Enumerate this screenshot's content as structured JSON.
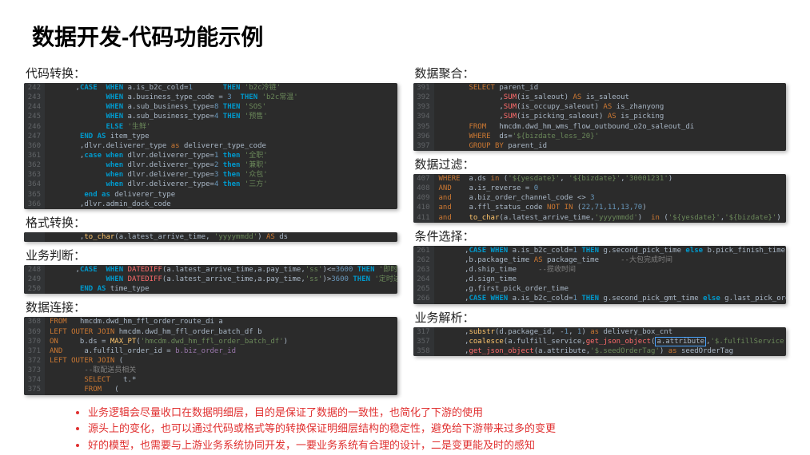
{
  "title": "数据开发-代码功能示例",
  "left": {
    "s1_label": "代码转换：",
    "s1_lines": [
      {
        "n": "242",
        "t": "      ,<kw2>CASE</kw2>  <kw2>WHEN</kw2> a.is_b2c_cold=<num>1</num>       <kw2>THEN</kw2> <str>'b2c冷链'</str>"
      },
      {
        "n": "243",
        "t": "             <kw2>WHEN</kw2> a.business_type_code = <num>3</num>  <kw2>THEN</kw2> <str>'b2c常温'</str>"
      },
      {
        "n": "244",
        "t": "             <kw2>WHEN</kw2> a.sub_business_type=<num>8</num> <kw2>THEN</kw2> <str>'SOS'</str>"
      },
      {
        "n": "245",
        "t": "             <kw2>WHEN</kw2> a.sub_business_type=<num>4</num> <kw2>THEN</kw2> <str>'预售'</str>"
      },
      {
        "n": "246",
        "t": "             <kw2>ELSE</kw2> <str>'生鲜'</str>"
      },
      {
        "n": "247",
        "t": "       <kw2>END AS</kw2> item_type"
      },
      {
        "n": "360",
        "t": "       ,dlvr.deliverer_type <kw>as</kw> deliverer_type_code"
      },
      {
        "n": "361",
        "t": "       ,<kw2>case when</kw2> dlvr.deliverer_type=<num>1</num> <kw2>then</kw2> <str>'全职'</str>"
      },
      {
        "n": "362",
        "t": "             <kw2>when</kw2> dlvr.deliverer_type=<num>2</num> <kw2>then</kw2> <str>'兼职'</str>"
      },
      {
        "n": "363",
        "t": "             <kw2>when</kw2> dlvr.deliverer_type=<num>3</num> <kw2>then</kw2> <str>'众包'</str>"
      },
      {
        "n": "364",
        "t": "             <kw2>when</kw2> dlvr.deliverer_type=<num>4</num> <kw2>then</kw2> <str>'三方'</str>"
      },
      {
        "n": "365",
        "t": "        <kw2>end as</kw2> deliverer_type"
      },
      {
        "n": "366",
        "t": "       ,dlvr.admin_dock_code"
      }
    ],
    "s2_label": "格式转换：",
    "s2_lines": [
      {
        "n": "",
        "t": "       ,<func>to_char</func>(a.latest_arrive_time, <str>'yyyymmdd'</str>) <kw>AS</kw> ds"
      }
    ],
    "s3_label": "业务判断：",
    "s3_lines": [
      {
        "n": "248",
        "t": "      ,<kw2>CASE</kw2>  <kw2>WHEN</kw2> <agg>DATEDIFF</agg>(a.latest_arrive_time,a.pay_time,<str>'ss'</str>)<=<num>3600</num> <kw2>THEN</kw2> <str>'即时达'</str>"
      },
      {
        "n": "249",
        "t": "             <kw2>WHEN</kw2> <agg>DATEDIFF</agg>(a.latest_arrive_time,a.pay_time,<str>'ss'</str>)><num>3600</num> <kw2>THEN</kw2> <str>'定时达'</str>"
      },
      {
        "n": "250",
        "t": "       <kw2>END AS</kw2> time_type"
      }
    ],
    "s4_label": "数据连接：",
    "s4_lines": [
      {
        "n": "368",
        "t": "<kw>FROM</kw>   hmcdm.dwd_hm_ffl_order_route_di a"
      },
      {
        "n": "369",
        "t": "<kw>LEFT OUTER JOIN</kw> hmcdm.dwd_hm_ffl_order_batch_df b"
      },
      {
        "n": "370",
        "t": "<kw>ON</kw>     b.ds = <func>MAX_PT</func>(<str>'hmcdm.dwd_hm_ffl_order_batch_df'</str>)"
      },
      {
        "n": "371",
        "t": "<kw>AND</kw>     a.fulfill_order_id = <ident>b.biz_order_id</ident>"
      },
      {
        "n": "372",
        "t": "<kw>LEFT OUTER JOIN</kw> ("
      },
      {
        "n": "373",
        "t": "        <cmt>--取配送员相关</cmt>"
      },
      {
        "n": "374",
        "t": "        <kw>SELECT</kw>   t.*"
      },
      {
        "n": "375",
        "t": "        <kw>FROM</kw>   ("
      }
    ]
  },
  "right": {
    "s1_label": "数据聚合：",
    "s1_lines": [
      {
        "n": "391",
        "t": "       <kw>SELECT</kw> parent_id"
      },
      {
        "n": "392",
        "t": "              ,<agg>SUM</agg>(is_saleout) <kw>AS</kw> is_saleout"
      },
      {
        "n": "393",
        "t": "              ,<agg>SUM</agg>(is_occupy_saleout) <kw>AS</kw> is_zhanyong"
      },
      {
        "n": "394",
        "t": "              ,<agg>SUM</agg>(is_picking_saleout) <kw>AS</kw> is_picking"
      },
      {
        "n": "395",
        "t": "       <kw>FROM</kw>   hmcdm.dwd_hm_wms_flow_outbound_o2o_saleout_di"
      },
      {
        "n": "396",
        "t": "       <kw>WHERE</kw>  ds=<str>'${bizdate_less_20}'</str>"
      },
      {
        "n": "397",
        "t": "       <kw>GROUP BY</kw> parent_id"
      }
    ],
    "s2_label": "数据过滤：",
    "s2_lines": [
      {
        "n": "407",
        "t": "<kw>WHERE</kw>  a.ds <kw>in</kw> (<str>'${yesdate}'</str>, <str>'${bizdate}'</str>,<str>'30001231'</str>)"
      },
      {
        "n": "408",
        "t": "<kw>AND</kw>    a.is_reverse = <num>0</num>"
      },
      {
        "n": "409",
        "t": "<kw>and</kw>    a.biz_order_channel_code <> <num>3</num>"
      },
      {
        "n": "410",
        "t": "<kw>and</kw>    a.ffl_status_code <kw>NOT IN</kw> (<num>22,71,11,13,70</num>)"
      },
      {
        "n": "411",
        "t": "<kw>and</kw>    <func>to_char</func>(a.latest_arrive_time,<str>'yyyymmdd'</str>)  <kw>in</kw> (<str>'${yesdate}'</str>,<str>'${bizdate}'</str>)"
      }
    ],
    "s3_label": "条件选择：",
    "s3_lines": [
      {
        "n": "261",
        "t": "      ,<kw2>CASE WHEN</kw2> a.is_b2c_cold=<num>1</num> <kw2>THEN</kw2> g.second_pick_time <kw2>else</kw2> b.pick_finish_time <kw2>end as</kw2> pick_finish_time"
      },
      {
        "n": "262",
        "t": "      ,b.package_time <kw>AS</kw> package_time     <cmt>--大包完成时间</cmt>"
      },
      {
        "n": "263",
        "t": "      ,d.ship_time     <cmt>--揽收时间</cmt>"
      },
      {
        "n": "264",
        "t": "      ,d.sign_time"
      },
      {
        "n": "265",
        "t": "      ,g.first_pick_order_time"
      },
      {
        "n": "266",
        "t": "      ,<kw2>CASE WHEN</kw2> a.is_b2c_cold=<num>1</num> <kw2>THEN</kw2> g.second_pick_gmt_time <kw2>else</kw2> g.last_pick_order_time <kw2>end as</kw2> last_pick"
      }
    ],
    "s4_label": "业务解析：",
    "s4_lines": [
      {
        "n": "317",
        "t": "      ,<func>substr</func>(d.package_id, -<num>1</num>, <num>1</num>) <kw>as</kw> delivery_box_cnt"
      },
      {
        "n": "357",
        "t": "      ,<func>coalesce</func>(a.fulfill_service,<agg>get_json_object</agg>(<hl-box>a.attribute</hl-box>,<str>'$.fulfillService'</str>)) <kw>as</kw> fulfill_service"
      },
      {
        "n": "358",
        "t": "      ,<agg>get_json_object</agg>(a.attribute,<str>'$.seedOrderTag'</str>) <kw>as</kw> seedOrderTag"
      }
    ]
  },
  "bullets": [
    "业务逻辑会尽量收口在数据明细层，目的是保证了数据的一致性，也简化了下游的使用",
    "源头上的变化，也可以通过代码或格式等的转换保证明细层结构的稳定性，避免给下游带来过多的变更",
    "好的模型，也需要与上游业务系统协同开发，一要业务系统有合理的设计，二是变更能及时的感知"
  ]
}
